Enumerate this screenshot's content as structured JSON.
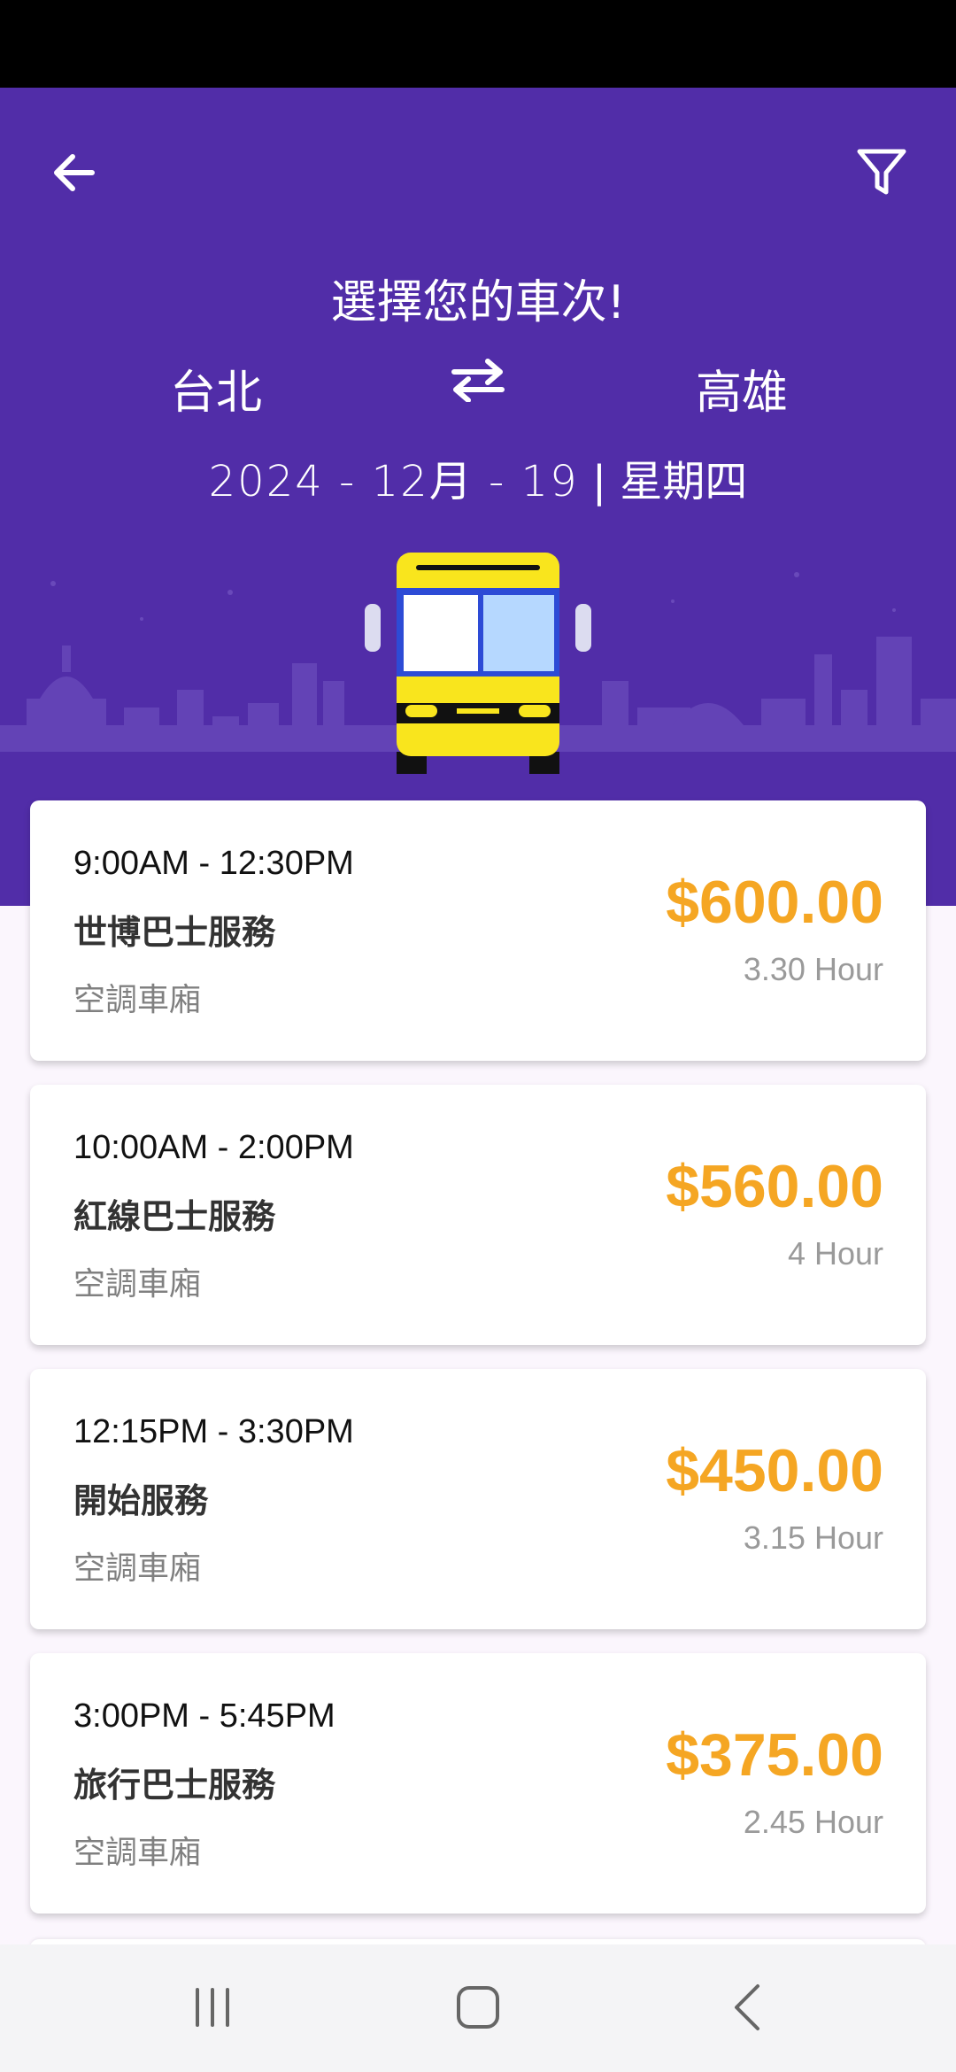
{
  "header": {
    "title": "選擇您的車次!",
    "from_city": "台北",
    "to_city": "高雄",
    "date": "2024 - 12月 - 19",
    "weekday": "星期四",
    "date_separator": "|"
  },
  "icons": {
    "back": "arrow-left-icon",
    "filter": "filter-funnel-icon",
    "swap": "swap-arrows-icon",
    "bus": "bus-illustration"
  },
  "trips": [
    {
      "time": "9:00AM - 12:30PM",
      "operator": "世博巴士服務",
      "type": "空調車廂",
      "price": "$600.00",
      "duration": "3.30 Hour"
    },
    {
      "time": "10:00AM - 2:00PM",
      "operator": "紅線巴士服務",
      "type": "空調車廂",
      "price": "$560.00",
      "duration": "4 Hour"
    },
    {
      "time": "12:15PM - 3:30PM",
      "operator": "開始服務",
      "type": "空調車廂",
      "price": "$450.00",
      "duration": "3.15 Hour"
    },
    {
      "time": "3:00PM - 5:45PM",
      "operator": "旅行巴士服務",
      "type": "空調車廂",
      "price": "$375.00",
      "duration": "2.45 Hour"
    }
  ],
  "colors": {
    "header": "#512da8",
    "price": "#f5a623",
    "background": "#fbf6fd"
  }
}
